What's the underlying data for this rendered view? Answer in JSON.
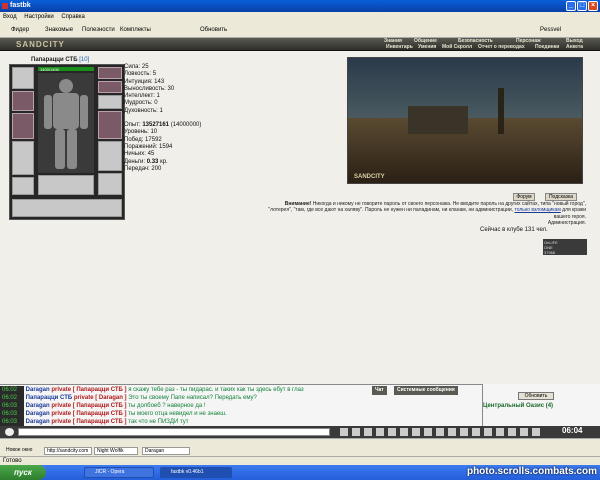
{
  "window": {
    "title": "fastbk"
  },
  "menu": [
    "Вход",
    "Настройки",
    "Справка"
  ],
  "toolbar": {
    "items": [
      "Фидер",
      "Знакомые",
      "Полезности",
      "Комплекты",
      "Обновить"
    ],
    "user": "Pessvel"
  },
  "game": {
    "logo": "SANDCITY",
    "nav_top": [
      "Знания",
      "Общение",
      "Безопасность",
      "Персонаж",
      "Выход"
    ],
    "nav_bottom": [
      "Инвентарь",
      "Умения",
      "Мой Скролл",
      "Отчет о переводах",
      "Поединки",
      "Анкета"
    ]
  },
  "character": {
    "name": "Папарацци СТБ",
    "level": "[10]",
    "hp": "1400/1400",
    "stats": [
      "Сила: 25",
      "Ловкость: 5",
      "Интуиция: 143",
      "Выносливость: 30",
      "Интеллект: 1",
      "Мудрость: 0",
      "Духовность: 1"
    ],
    "exp_label": "Опыт:",
    "exp_value": "13527161",
    "exp_next": "(14000000)",
    "level_line": "Уровень: 10",
    "wins": "Побед: 17592",
    "losses": "Поражений: 1594",
    "draws": "Ничьих: 45",
    "money_label": "Деньги:",
    "money_value": "0.33",
    "money_unit": "кр.",
    "transfers": "Передач: 200"
  },
  "scene": {
    "badge": "SANDCITY"
  },
  "buttons": {
    "forum": "Форум",
    "hint": "Подсказка"
  },
  "warning": {
    "bold": "Внимание!",
    "line1": "Никогда и никому не говорите пароль от своего персонажа. Не вводите пароль на других сайтах, типа \"новый город\",",
    "line2": "\"лотерея\", \"там, где все дают на халяву\". Пароль не нужен ни паладинам, ни кланам, ни администрации,",
    "link": "только взломщикам",
    "line2b": "для кражи",
    "line3": "вашего героя.",
    "line4": "Администрация."
  },
  "online": "Сейчас в клубе 131 чел.",
  "counter": [
    "OnLIFE",
    "ONE",
    "37966"
  ],
  "chat": {
    "messages": [
      {
        "time": "06:02",
        "nick": "Daragan",
        "priv": "private [ Папарацци СТБ ]",
        "text": "я скажу тебе раз - ты пидарас. и таких как ты здесь ебут в глаз"
      },
      {
        "time": "06:02",
        "nick": "Папарацци СТБ",
        "priv": "private [ Daragan ]",
        "text": "Это ты своему Папе написал? Передать ему?"
      },
      {
        "time": "06:03",
        "nick": "Daragan",
        "priv": "private [ Папарацци СТБ ]",
        "text": "ты долбоеб ? наверное да !"
      },
      {
        "time": "06:03",
        "nick": "Daragan",
        "priv": "private [ Папарацци СТБ ]",
        "text": "ты моего отца невидел и не знаеш."
      },
      {
        "time": "06:03",
        "nick": "Daragan",
        "priv": "private [ Папарацци СТБ ]",
        "text": "так что не ПИЗДИ тут"
      }
    ],
    "tabs": [
      "Чат",
      "Системные сообщения"
    ]
  },
  "right_panel": {
    "refresh": "Обновить",
    "location": "Центральный Оазис (4)"
  },
  "clock": "06:04",
  "address": {
    "new_window": "Новое окно",
    "url": "http://sandcity.com",
    "tab1": "Night Wolfik",
    "tab2": "Daragan"
  },
  "statusbar": "Готово",
  "taskbar": {
    "start": "пуск",
    "items": [
      "JICR - Opera",
      "fastbk v0.46b1"
    ]
  },
  "watermark": "photo.scrolls.combats.com"
}
